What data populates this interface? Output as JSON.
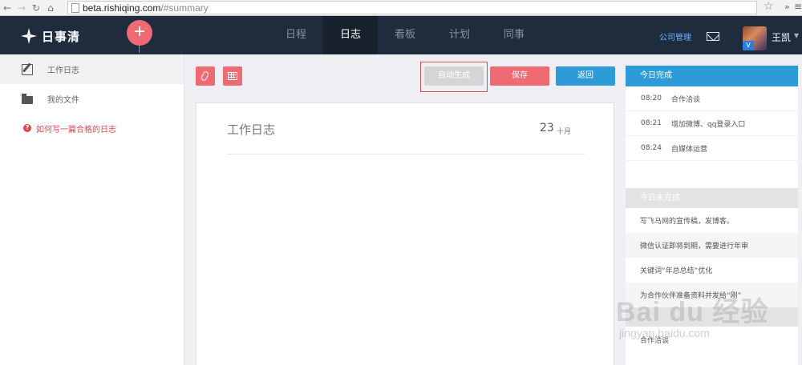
{
  "browser": {
    "url_host": "beta.rishiqing.com",
    "url_path": "/#summary",
    "more_glyph": "»"
  },
  "header": {
    "logo_text": "日事清",
    "add_glyph": "+",
    "tabs": [
      {
        "label": "日程",
        "active": false
      },
      {
        "label": "日志",
        "active": true
      },
      {
        "label": "看板",
        "active": false
      },
      {
        "label": "计划",
        "active": false
      },
      {
        "label": "同事",
        "active": false
      }
    ],
    "company_link": "公司管理",
    "username": "王凯",
    "avatar_badge": "V"
  },
  "sidebar": {
    "items": [
      {
        "label": "工作日志",
        "icon": "edit-icon"
      },
      {
        "label": "我的文件",
        "icon": "folder-icon"
      }
    ],
    "help_link": "如何写一篇合格的日志",
    "help_glyph": "?"
  },
  "toolbar": {
    "auto_label": "自动生成",
    "save_label": "保存",
    "back_label": "返回"
  },
  "card": {
    "title": "工作日志",
    "day": "23",
    "month": "十月"
  },
  "panel": {
    "done_heading": "今日完成",
    "done": [
      {
        "time": "08:20",
        "title": "合作洽谈"
      },
      {
        "time": "08:21",
        "title": "增加微博、qq登录入口"
      },
      {
        "time": "08:24",
        "title": "自媒体运营"
      }
    ],
    "pending_heading": "今日未完成",
    "pending": [
      "写飞马网的宣传稿，发博客。",
      "微信认证即将到期，需要进行年审",
      "关键词“年总总结”优化",
      "为合作伙伴准备资料并发给“刚”"
    ],
    "late_items": [
      "合作洽谈"
    ]
  },
  "watermark": {
    "big": "Bai du 经验",
    "small": "jingyan.baidu.com"
  },
  "colors": {
    "nav_bg": "#1f2c3e",
    "accent_red": "#ee6b73",
    "accent_blue": "#2f9ad8"
  }
}
